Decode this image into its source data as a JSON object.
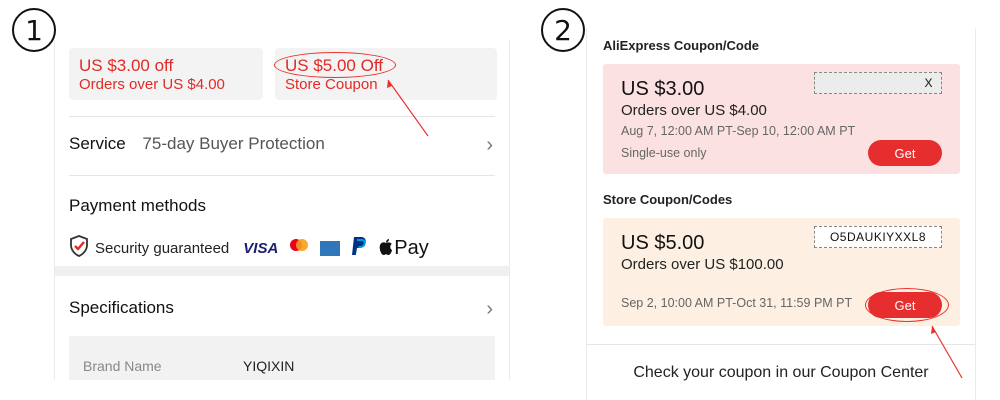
{
  "steps": {
    "one": "1",
    "two": "2"
  },
  "panel1": {
    "coupon_platform": {
      "line1": "US $3.00 off",
      "line2": "Orders over US $4.00"
    },
    "coupon_store": {
      "line1": "US $5.00 Off",
      "line2": "Store Coupon"
    },
    "service": {
      "label": "Service",
      "value": "75-day Buyer Protection"
    },
    "payment": {
      "title": "Payment methods",
      "security_text": "Security guaranteed",
      "visa_label": "VISA",
      "applepay_label": "Pay"
    },
    "specifications": {
      "title": "Specifications",
      "brand_key": "Brand Name",
      "brand_value": "YIQIXIN"
    }
  },
  "panel2": {
    "aliexpress_heading": "AliExpress Coupon/Code",
    "ali_coupon": {
      "amount": "US $3.00",
      "condition": "Orders over US $4.00",
      "dates": "Aug 7, 12:00 AM PT-Sep 10, 12:00 AM PT",
      "note": "Single-use only",
      "code": "X",
      "button": "Get"
    },
    "store_heading": "Store Coupon/Codes",
    "store_coupon": {
      "amount": "US $5.00",
      "condition": "Orders over US $100.00",
      "dates": "Sep 2, 10:00 AM PT-Oct 31, 11:59 PM PT",
      "code": "O5DAUKIYXXL8",
      "button": "Get"
    },
    "coupon_center_text": "Check your coupon in our Coupon Center"
  },
  "colors": {
    "accent_red": "#e62e2e",
    "platform_card": "#fbe1e1",
    "store_card": "#fdf0e2"
  }
}
